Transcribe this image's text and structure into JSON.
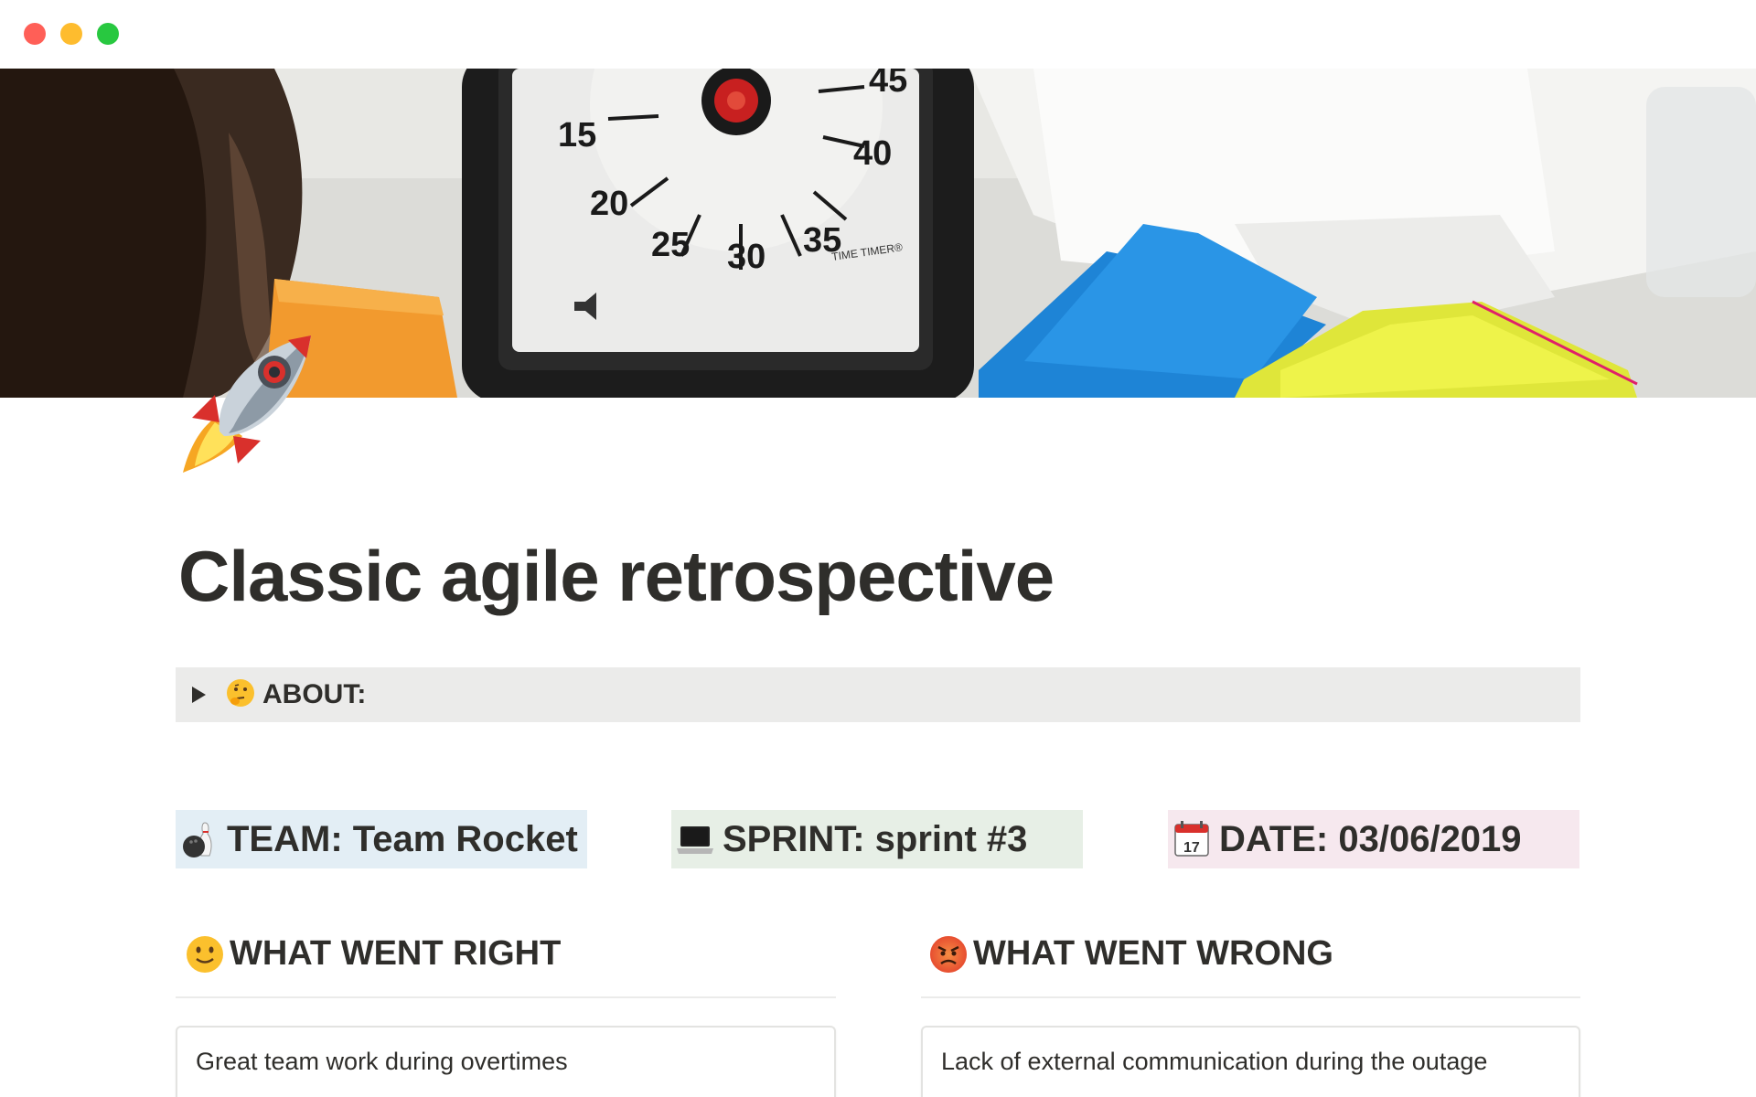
{
  "window": {
    "controls": [
      "close",
      "minimize",
      "zoom"
    ]
  },
  "cover": {
    "description_icon": "cover-image",
    "timer_brand": "TIME TIMER®",
    "timer_numbers": [
      "45",
      "15",
      "40",
      "20",
      "35",
      "25",
      "30"
    ]
  },
  "page": {
    "icon": "rocket-icon",
    "title": "Classic agile retrospective"
  },
  "about": {
    "label": "ABOUT:",
    "icon": "thinking-face-icon"
  },
  "info": {
    "team": {
      "text": "TEAM: Team Rocket",
      "icon": "bowling-icon",
      "bg": "#e3eef5"
    },
    "sprint": {
      "text": "SPRINT: sprint #3",
      "icon": "laptop-icon",
      "bg": "#e7efe6"
    },
    "date": {
      "text": "DATE: 03/06/2019",
      "icon": "calendar-icon",
      "bg": "#f6e8ee",
      "calendar_day": "17"
    }
  },
  "sections": {
    "right": {
      "heading": "WHAT WENT RIGHT",
      "icon": "slightly-smiling-face-icon",
      "cards": [
        "Great team work during overtimes"
      ]
    },
    "wrong": {
      "heading": "WHAT WENT WRONG",
      "icon": "angry-face-icon",
      "cards": [
        "Lack of external communication during the outage"
      ]
    }
  },
  "colors": {
    "text": "#2f2e2b",
    "toggle_bg": "#ebebea"
  }
}
